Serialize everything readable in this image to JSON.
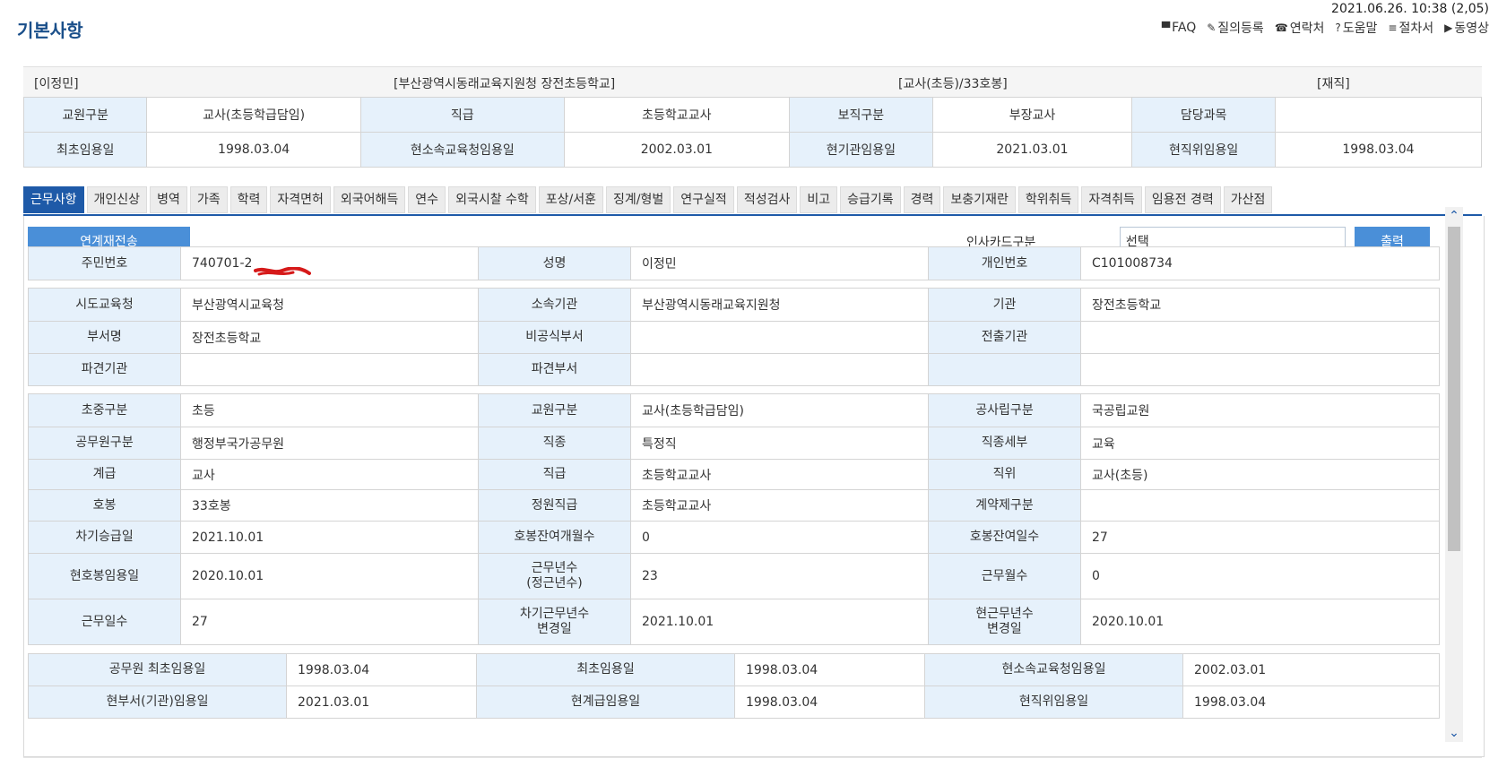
{
  "page": {
    "title": "기본사항",
    "datetime": "2021.06.26. 10:38 (2,05)",
    "links": [
      {
        "icon": "faq-icon",
        "glyph": "▀",
        "label": "FAQ"
      },
      {
        "icon": "pencil-icon",
        "glyph": "✎",
        "label": "질의등록"
      },
      {
        "icon": "phone-icon",
        "glyph": "☎",
        "label": "연락처"
      },
      {
        "icon": "help-icon",
        "glyph": "?",
        "label": "도움말"
      },
      {
        "icon": "list-icon",
        "glyph": "≡",
        "label": "절차서"
      },
      {
        "icon": "play-icon",
        "glyph": "▶",
        "label": "동영상"
      }
    ]
  },
  "summary": {
    "name": "[이정민]",
    "org": "[부산광역시동래교육지원청 장전초등학교]",
    "rank": "[교사(초등)/33호봉]",
    "status": "[재직]"
  },
  "top_table": [
    [
      [
        "교원구분",
        "교사(초등학급담임)"
      ],
      [
        "직급",
        "초등학교교사"
      ],
      [
        "보직구분",
        "부장교사"
      ],
      [
        "담당과목",
        ""
      ]
    ],
    [
      [
        "최초임용일",
        "1998.03.04"
      ],
      [
        "현소속교육청임용일",
        "2002.03.01"
      ],
      [
        "현기관임용일",
        "2021.03.01"
      ],
      [
        "현직위임용일",
        "1998.03.04"
      ]
    ]
  ],
  "tabs": [
    "근무사항",
    "개인신상",
    "병역",
    "가족",
    "학력",
    "자격면허",
    "외국어해득",
    "연수",
    "외국시찰 수학",
    "포상/서훈",
    "징계/형벌",
    "연구실적",
    "적성검사",
    "비고",
    "승급기록",
    "경력",
    "보충기재란",
    "학위취득",
    "자격취득",
    "임용전 경력",
    "가산점"
  ],
  "toolbar": {
    "resend": "연계재전송",
    "card_label": "인사카드구분",
    "select_value": "선택",
    "print": "출력"
  },
  "sections": [
    [
      [
        [
          "주민번호",
          "740701-2"
        ],
        [
          "성명",
          "이정민"
        ],
        [
          "개인번호",
          "C101008734"
        ]
      ]
    ],
    [
      [
        [
          "시도교육청",
          "부산광역시교육청"
        ],
        [
          "소속기관",
          "부산광역시동래교육지원청"
        ],
        [
          "기관",
          "장전초등학교"
        ]
      ],
      [
        [
          "부서명",
          "장전초등학교"
        ],
        [
          "비공식부서",
          ""
        ],
        [
          "전출기관",
          ""
        ]
      ],
      [
        [
          "파견기관",
          ""
        ],
        [
          "파견부서",
          ""
        ],
        [
          "",
          ""
        ]
      ]
    ],
    [
      [
        [
          "초중구분",
          "초등"
        ],
        [
          "교원구분",
          "교사(초등학급담임)"
        ],
        [
          "공사립구분",
          "국공립교원"
        ]
      ],
      [
        [
          "공무원구분",
          "행정부국가공무원"
        ],
        [
          "직종",
          "특정직"
        ],
        [
          "직종세부",
          "교육"
        ]
      ],
      [
        [
          "계급",
          "교사"
        ],
        [
          "직급",
          "초등학교교사"
        ],
        [
          "직위",
          "교사(초등)"
        ]
      ],
      [
        [
          "호봉",
          "33호봉"
        ],
        [
          "정원직급",
          "초등학교교사"
        ],
        [
          "계약제구분",
          ""
        ]
      ],
      [
        [
          "차기승급일",
          "2021.10.01"
        ],
        [
          "호봉잔여개월수",
          "0"
        ],
        [
          "호봉잔여일수",
          "27"
        ]
      ],
      [
        [
          "현호봉임용일",
          "2020.10.01"
        ],
        [
          "근무년수\n(정근년수)",
          "23"
        ],
        [
          "근무월수",
          "0"
        ]
      ],
      [
        [
          "근무일수",
          "27"
        ],
        [
          "차기근무년수\n변경일",
          "2021.10.01"
        ],
        [
          "현근무년수\n변경일",
          "2020.10.01"
        ]
      ]
    ],
    [
      [
        [
          "공무원 최초임용일",
          "1998.03.04"
        ],
        [
          "최초임용일",
          "1998.03.04"
        ],
        [
          "현소속교육청임용일",
          "2002.03.01"
        ]
      ],
      [
        [
          "현부서(기관)임용일",
          "2021.03.01"
        ],
        [
          "현계급임용일",
          "1998.03.04"
        ],
        [
          "현직위임용일",
          "1998.03.04"
        ]
      ]
    ]
  ]
}
